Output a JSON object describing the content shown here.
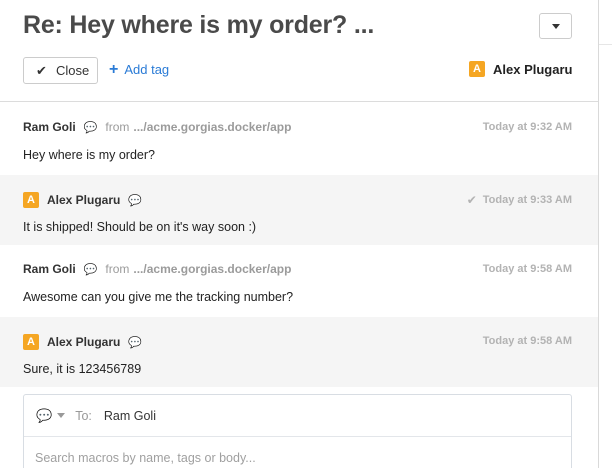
{
  "ticket": {
    "title": "Re: Hey where is my order? ...",
    "close_label": "Close",
    "add_tag_label": "Add tag",
    "assignee": {
      "initial": "A",
      "name": "Alex Plugaru"
    }
  },
  "messages": [
    {
      "author": "Ram Goli",
      "from_prefix": "from",
      "from_path": ".../acme.gorgias.docker/app",
      "time": "Today at 9:32 AM",
      "body": "Hey where is my order?"
    },
    {
      "author_initial": "A",
      "author": "Alex Plugaru",
      "time": "Today at 9:33 AM",
      "body": "It is shipped! Should be on it's way soon :)"
    },
    {
      "author": "Ram Goli",
      "from_prefix": "from",
      "from_path": ".../acme.gorgias.docker/app",
      "time": "Today at 9:58 AM",
      "body": "Awesome can you give me the tracking number?"
    },
    {
      "author_initial": "A",
      "author": "Alex Plugaru",
      "time": "Today at 9:58 AM",
      "body": "Sure, it is 123456789"
    }
  ],
  "composer": {
    "to_label": "To:",
    "to_value": "Ram Goli",
    "placeholder": "Search macros by name, tags or body..."
  },
  "icons": {
    "check": "check-icon",
    "plus": "plus-icon",
    "chat": "chat-bubbles-icon",
    "delivered": "checkmark-icon",
    "caret": "caret-down-icon"
  },
  "colors": {
    "accent_blue": "#2a7bd6",
    "agent_badge": "#f5a623",
    "channel_purple": "#9b30c9"
  }
}
